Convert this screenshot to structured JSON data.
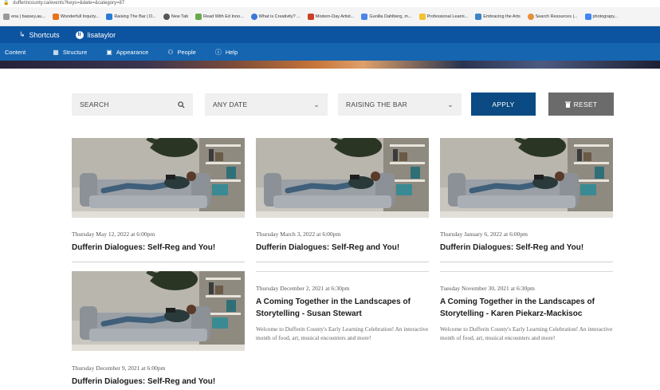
{
  "browser": {
    "url": "dufferincounty.ca/events?keys=&date=&category=87",
    "bookmarks": [
      {
        "label": "ena | bassey.au...",
        "color": "#999999"
      },
      {
        "label": "Wonderfull Inquiry...",
        "color": "#e8731a"
      },
      {
        "label": "Raising The Bar | D...",
        "color": "#2a7bd6"
      },
      {
        "label": "New Tab",
        "color": "#555555"
      },
      {
        "label": "Read With Ed Inno...",
        "color": "#6aa84f"
      },
      {
        "label": "What is Creativity? ...",
        "color": "#3c78d8"
      },
      {
        "label": "Modern-Day Artist...",
        "color": "#cc4125"
      },
      {
        "label": "Gunilla Dahlberg, m...",
        "color": "#4a86e8"
      },
      {
        "label": "Professional Learni...",
        "color": "#f1c232"
      },
      {
        "label": "Embracing the Arts",
        "color": "#3d85c6"
      },
      {
        "label": "Search Resources |...",
        "color": "#e69138"
      },
      {
        "label": "photograpy...",
        "color": "#4285f4"
      }
    ]
  },
  "toolbar": {
    "shortcuts": "Shortcuts",
    "user": "lisataylor",
    "user_initial": "li",
    "tray": [
      "Content",
      "Structure",
      "Appearance",
      "People",
      "Help"
    ]
  },
  "filters": {
    "search_placeholder": "SEARCH",
    "date_value": "ANY DATE",
    "category_value": "RAISING THE BAR",
    "apply_label": "APPLY",
    "reset_label": "RESET"
  },
  "events": [
    {
      "date": "Thursday May 12, 2022 at 6:00pm",
      "title": "Dufferin Dialogues: Self-Reg and You!",
      "description": ""
    },
    {
      "date": "Thursday March 3, 2022 at 6:00pm",
      "title": "Dufferin Dialogues: Self-Reg and You!",
      "description": ""
    },
    {
      "date": "Thursday January 6, 2022 at 6:00pm",
      "title": "Dufferin Dialogues: Self-Reg and You!",
      "description": ""
    },
    {
      "date": "Thursday December 9, 2021 at 6:00pm",
      "title": "Dufferin Dialogues: Self-Reg and You!",
      "description": ""
    },
    {
      "date": "Thursday December 2, 2021 at 6:30pm",
      "title": "A Coming Together in the Landscapes of Storytelling - Susan Stewart",
      "description": "Welcome to Dufferin County's Early Learning Celebration! An interactive month of food, art, musical encounters and more!"
    },
    {
      "date": "Tuesday November 30, 2021 at 6:30pm",
      "title": "A Coming Together in the Landscapes of Storytelling - Karen Piekarz-Mackisoc",
      "description": "Welcome to Dufferin County's Early Learning Celebration! An interactive month of food, art, musical encounters and more!"
    }
  ]
}
